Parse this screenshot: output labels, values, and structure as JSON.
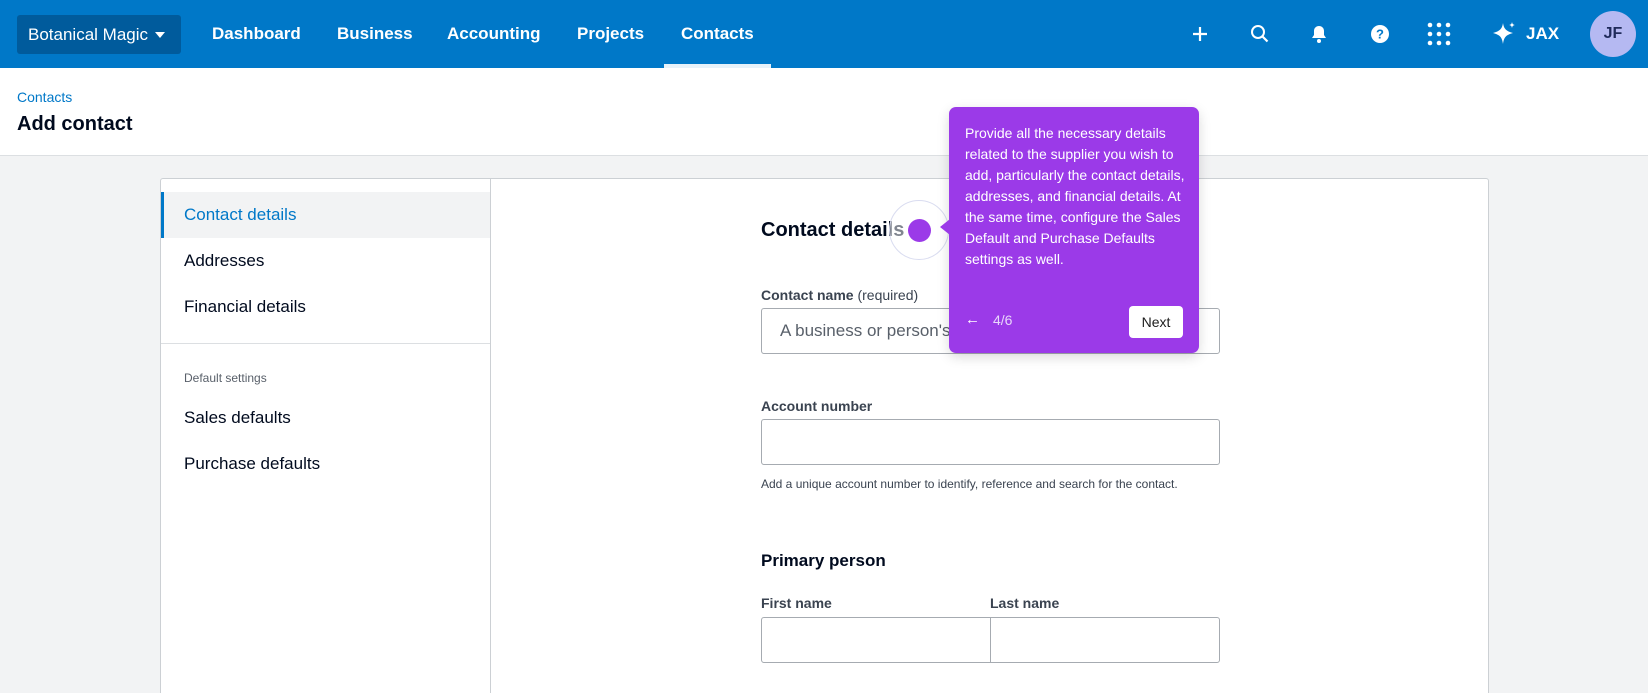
{
  "topbar": {
    "org_name": "Botanical Magic",
    "nav": [
      "Dashboard",
      "Business",
      "Accounting",
      "Projects",
      "Contacts"
    ],
    "active_nav": "Contacts",
    "jax_label": "JAX",
    "avatar_initials": "JF",
    "icons": [
      "plus-icon",
      "search-icon",
      "bell-icon",
      "help-icon",
      "apps-grid-icon",
      "sparkle-icon"
    ]
  },
  "header": {
    "breadcrumb": "Contacts",
    "title": "Add contact"
  },
  "sidebar": {
    "items": [
      "Contact details",
      "Addresses",
      "Financial details"
    ],
    "section_label": "Default settings",
    "default_items": [
      "Sales defaults",
      "Purchase defaults"
    ]
  },
  "form": {
    "section_title": "Contact details",
    "contact_name_label": "Contact name",
    "contact_name_required": "(required)",
    "contact_name_placeholder": "A business or person's",
    "account_number_label": "Account number",
    "account_number_help": "Add a unique account number to identify, reference and search for the contact.",
    "primary_person_title": "Primary person",
    "first_name_label": "First name",
    "last_name_label": "Last name"
  },
  "tour": {
    "text": "Provide all the necessary details related to the supplier you wish to add, particularly the contact details, addresses, and financial details. At the same time, configure the Sales Default and Purchase Defaults settings as well.",
    "back_symbol": "←",
    "step": "4/6",
    "next_label": "Next",
    "color": "#9b3ae8"
  }
}
